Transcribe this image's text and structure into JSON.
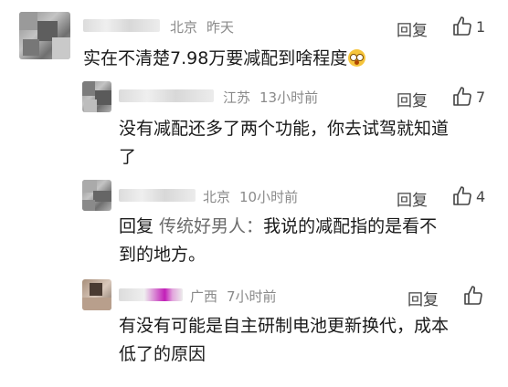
{
  "comments": [
    {
      "location": "北京",
      "time": "昨天",
      "text": "实在不清楚7.98万要减配到啥程度",
      "reply_label": "回复",
      "like_count": "1"
    },
    {
      "location": "江苏",
      "time": "13小时前",
      "text_line1": "没有减配还多了两个功能，你去试驾就知道",
      "text_line2": "了",
      "reply_label": "回复",
      "like_count": "7"
    },
    {
      "location": "北京",
      "time": "10小时前",
      "prefix": "回复 ",
      "mention": "传统好男人：",
      "text_line1_rest": "我说的减配指的是看不",
      "text_line2": "到的地方。",
      "reply_label": "回复",
      "like_count": "4"
    },
    {
      "location": "广西",
      "time": "7小时前",
      "text_line1": "有没有可能是自主研制电池更新换代，成本",
      "text_line2": "低了的原因",
      "reply_label": "回复",
      "like_count": ""
    }
  ],
  "icons": {
    "like": "thumbs-up-icon",
    "emoji": "astonished-face-emoji"
  }
}
